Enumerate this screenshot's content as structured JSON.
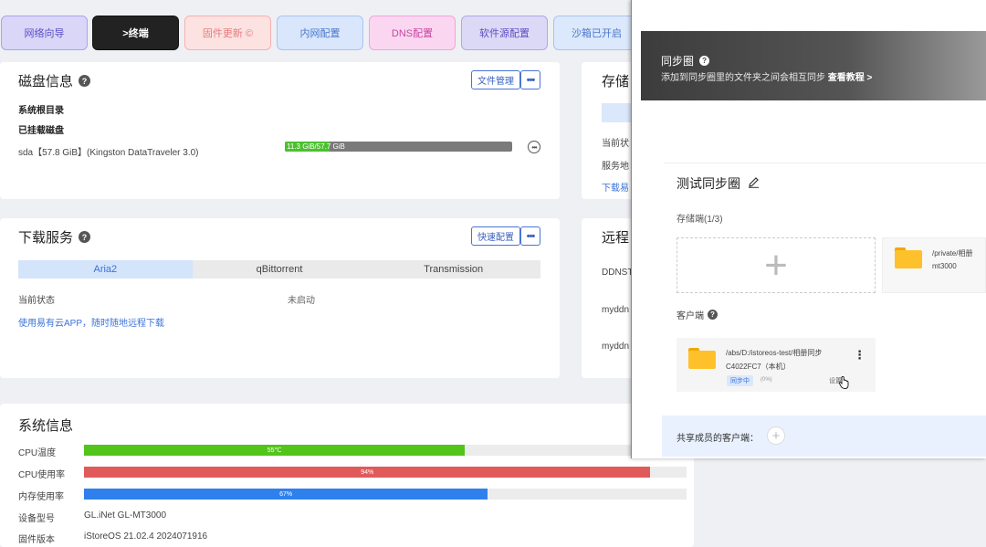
{
  "nav": {
    "items": [
      "网络向导",
      ">终端",
      "固件更新 ©",
      "内网配置",
      "DNS配置",
      "软件源配置",
      "沙箱已开启"
    ]
  },
  "disk": {
    "title": "磁盘信息",
    "file_manager_btn": "文件管理",
    "more_btn": "•••",
    "root_label": "系统根目录",
    "mounted_label": "已挂载磁盘",
    "disk_name": "sda【57.8 GiB】(Kingston DataTraveler 3.0)",
    "usage_text": "11.3 GiB/57.7 GiB",
    "usage_fraction": 0.196,
    "row_more": "•••"
  },
  "storage": {
    "title": "存储",
    "status_label": "当前状",
    "service_label": "服务地",
    "download_link": "下载易"
  },
  "download": {
    "title": "下载服务",
    "quick_config_btn": "快速配置",
    "more_btn": "•••",
    "tabs": [
      "Aria2",
      "qBittorrent",
      "Transmission"
    ],
    "status_label": "当前状态",
    "status_value": "未启动",
    "app_link": "使用易有云APP，随时随地远程下载"
  },
  "remote": {
    "title": "远程",
    "rows": [
      "DDNST",
      "myddn",
      "myddn"
    ]
  },
  "system": {
    "title": "系统信息",
    "cpu_temp_label": "CPU温度",
    "cpu_temp_value": "55℃",
    "cpu_temp_fraction": 0.632,
    "cpu_usage_label": "CPU使用率",
    "cpu_usage_value": "94%",
    "cpu_usage_fraction": 0.94,
    "mem_label": "内存使用率",
    "mem_value": "67%",
    "mem_fraction": 0.67,
    "device_label": "设备型号",
    "device_value": "GL.iNet GL-MT3000",
    "firmware_label": "固件版本",
    "firmware_value": "iStoreOS 21.02.4 2024071916"
  },
  "sync": {
    "title": "同步圈",
    "subtitle": "添加到同步圈里的文件夹之间会相互同步",
    "tutorial_link": "查看教程 >",
    "ring_name": "测试同步圈",
    "edit_icon": "pencil-icon",
    "storage_label": "存储端(1/3)",
    "add_symbol": "+",
    "storage_path": "/private/相册",
    "storage_device": "mt3000",
    "client_label": "客户端",
    "client_path": "/abs/D:/istoreos-test/相册同步",
    "client_device": "C4022FC7（本机）",
    "client_status": "同步中",
    "client_progress": "(0%)",
    "client_action": "设置",
    "kebab": "⋮",
    "share_label": "共享成员的客户端：",
    "share_add": "+"
  },
  "colors": {
    "cpu_temp": "#52c41a",
    "cpu_usage": "#e05a5a",
    "memory": "#2f80ed",
    "accent": "#3a73d9"
  }
}
